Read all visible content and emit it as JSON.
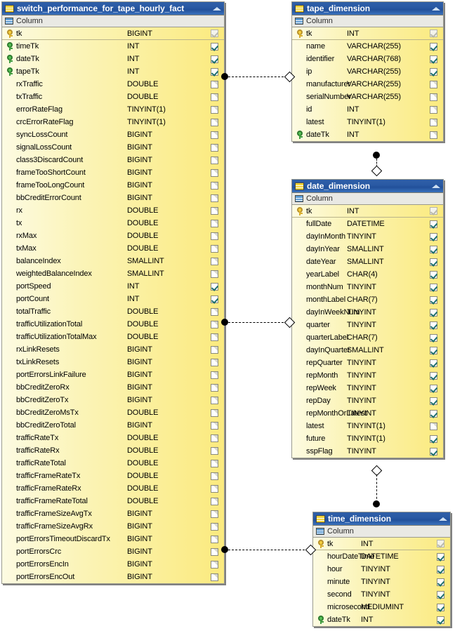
{
  "diagram": {
    "group_header_label": "Column",
    "tables": [
      {
        "id": "fact",
        "name": "switch_performance_for_tape_hourly_fact",
        "columns": [
          {
            "name": "tk",
            "type": "BIGINT",
            "key": "pk",
            "checked": "disabled"
          },
          {
            "name": "timeTk",
            "type": "INT",
            "key": "fk",
            "checked": "checked"
          },
          {
            "name": "dateTk",
            "type": "INT",
            "key": "fk",
            "checked": "checked"
          },
          {
            "name": "tapeTk",
            "type": "INT",
            "key": "fk",
            "checked": "checked"
          },
          {
            "name": "rxTraffic",
            "type": "DOUBLE",
            "key": "",
            "checked": "empty"
          },
          {
            "name": "txTraffic",
            "type": "DOUBLE",
            "key": "",
            "checked": "empty"
          },
          {
            "name": "errorRateFlag",
            "type": "TINYINT(1)",
            "key": "",
            "checked": "empty"
          },
          {
            "name": "crcErrorRateFlag",
            "type": "TINYINT(1)",
            "key": "",
            "checked": "empty"
          },
          {
            "name": "syncLossCount",
            "type": "BIGINT",
            "key": "",
            "checked": "empty"
          },
          {
            "name": "signalLossCount",
            "type": "BIGINT",
            "key": "",
            "checked": "empty"
          },
          {
            "name": "class3DiscardCount",
            "type": "BIGINT",
            "key": "",
            "checked": "empty"
          },
          {
            "name": "frameTooShortCount",
            "type": "BIGINT",
            "key": "",
            "checked": "empty"
          },
          {
            "name": "frameTooLongCount",
            "type": "BIGINT",
            "key": "",
            "checked": "empty"
          },
          {
            "name": "bbCreditErrorCount",
            "type": "BIGINT",
            "key": "",
            "checked": "empty"
          },
          {
            "name": "rx",
            "type": "DOUBLE",
            "key": "",
            "checked": "empty"
          },
          {
            "name": "tx",
            "type": "DOUBLE",
            "key": "",
            "checked": "empty"
          },
          {
            "name": "rxMax",
            "type": "DOUBLE",
            "key": "",
            "checked": "empty"
          },
          {
            "name": "txMax",
            "type": "DOUBLE",
            "key": "",
            "checked": "empty"
          },
          {
            "name": "balanceIndex",
            "type": "SMALLINT",
            "key": "",
            "checked": "empty"
          },
          {
            "name": "weightedBalanceIndex",
            "type": "SMALLINT",
            "key": "",
            "checked": "empty"
          },
          {
            "name": "portSpeed",
            "type": "INT",
            "key": "",
            "checked": "checked"
          },
          {
            "name": "portCount",
            "type": "INT",
            "key": "",
            "checked": "checked"
          },
          {
            "name": "totalTraffic",
            "type": "DOUBLE",
            "key": "",
            "checked": "empty"
          },
          {
            "name": "trafficUtilizationTotal",
            "type": "DOUBLE",
            "key": "",
            "checked": "empty"
          },
          {
            "name": "trafficUtilizationTotalMax",
            "type": "DOUBLE",
            "key": "",
            "checked": "empty"
          },
          {
            "name": "rxLinkResets",
            "type": "BIGINT",
            "key": "",
            "checked": "empty"
          },
          {
            "name": "txLinkResets",
            "type": "BIGINT",
            "key": "",
            "checked": "empty"
          },
          {
            "name": "portErrorsLinkFailure",
            "type": "BIGINT",
            "key": "",
            "checked": "empty"
          },
          {
            "name": "bbCreditZeroRx",
            "type": "BIGINT",
            "key": "",
            "checked": "empty"
          },
          {
            "name": "bbCreditZeroTx",
            "type": "BIGINT",
            "key": "",
            "checked": "empty"
          },
          {
            "name": "bbCreditZeroMsTx",
            "type": "DOUBLE",
            "key": "",
            "checked": "empty"
          },
          {
            "name": "bbCreditZeroTotal",
            "type": "BIGINT",
            "key": "",
            "checked": "empty"
          },
          {
            "name": "trafficRateTx",
            "type": "DOUBLE",
            "key": "",
            "checked": "empty"
          },
          {
            "name": "trafficRateRx",
            "type": "DOUBLE",
            "key": "",
            "checked": "empty"
          },
          {
            "name": "trafficRateTotal",
            "type": "DOUBLE",
            "key": "",
            "checked": "empty"
          },
          {
            "name": "trafficFrameRateTx",
            "type": "DOUBLE",
            "key": "",
            "checked": "empty"
          },
          {
            "name": "trafficFrameRateRx",
            "type": "DOUBLE",
            "key": "",
            "checked": "empty"
          },
          {
            "name": "trafficFrameRateTotal",
            "type": "DOUBLE",
            "key": "",
            "checked": "empty"
          },
          {
            "name": "trafficFrameSizeAvgTx",
            "type": "BIGINT",
            "key": "",
            "checked": "empty"
          },
          {
            "name": "trafficFrameSizeAvgRx",
            "type": "BIGINT",
            "key": "",
            "checked": "empty"
          },
          {
            "name": "portErrorsTimeoutDiscardTx",
            "type": "BIGINT",
            "key": "",
            "checked": "empty"
          },
          {
            "name": "portErrorsCrc",
            "type": "BIGINT",
            "key": "",
            "checked": "empty"
          },
          {
            "name": "portErrorsEncIn",
            "type": "BIGINT",
            "key": "",
            "checked": "empty"
          },
          {
            "name": "portErrorsEncOut",
            "type": "BIGINT",
            "key": "",
            "checked": "empty"
          }
        ]
      },
      {
        "id": "tape",
        "name": "tape_dimension",
        "columns": [
          {
            "name": "tk",
            "type": "INT",
            "key": "pk",
            "checked": "disabled"
          },
          {
            "name": "name",
            "type": "VARCHAR(255)",
            "key": "",
            "checked": "checked"
          },
          {
            "name": "identifier",
            "type": "VARCHAR(768)",
            "key": "",
            "checked": "checked"
          },
          {
            "name": "ip",
            "type": "VARCHAR(255)",
            "key": "",
            "checked": "checked"
          },
          {
            "name": "manufacturer",
            "type": "VARCHAR(255)",
            "key": "",
            "checked": "empty"
          },
          {
            "name": "serialNumber",
            "type": "VARCHAR(255)",
            "key": "",
            "checked": "empty"
          },
          {
            "name": "id",
            "type": "INT",
            "key": "",
            "checked": "empty"
          },
          {
            "name": "latest",
            "type": "TINYINT(1)",
            "key": "",
            "checked": "empty"
          },
          {
            "name": "dateTk",
            "type": "INT",
            "key": "fk",
            "checked": "empty"
          }
        ]
      },
      {
        "id": "date",
        "name": "date_dimension",
        "columns": [
          {
            "name": "tk",
            "type": "INT",
            "key": "pk",
            "checked": "disabled"
          },
          {
            "name": "fullDate",
            "type": "DATETIME",
            "key": "",
            "checked": "checked"
          },
          {
            "name": "dayInMonth",
            "type": "TINYINT",
            "key": "",
            "checked": "checked"
          },
          {
            "name": "dayInYear",
            "type": "SMALLINT",
            "key": "",
            "checked": "checked"
          },
          {
            "name": "dateYear",
            "type": "SMALLINT",
            "key": "",
            "checked": "checked"
          },
          {
            "name": "yearLabel",
            "type": "CHAR(4)",
            "key": "",
            "checked": "checked"
          },
          {
            "name": "monthNum",
            "type": "TINYINT",
            "key": "",
            "checked": "checked"
          },
          {
            "name": "monthLabel",
            "type": "CHAR(7)",
            "key": "",
            "checked": "checked"
          },
          {
            "name": "dayInWeekNum",
            "type": "TINYINT",
            "key": "",
            "checked": "checked"
          },
          {
            "name": "quarter",
            "type": "TINYINT",
            "key": "",
            "checked": "checked"
          },
          {
            "name": "quarterLabel",
            "type": "CHAR(7)",
            "key": "",
            "checked": "checked"
          },
          {
            "name": "dayInQuarter",
            "type": "SMALLINT",
            "key": "",
            "checked": "checked"
          },
          {
            "name": "repQuarter",
            "type": "TINYINT",
            "key": "",
            "checked": "checked"
          },
          {
            "name": "repMonth",
            "type": "TINYINT",
            "key": "",
            "checked": "checked"
          },
          {
            "name": "repWeek",
            "type": "TINYINT",
            "key": "",
            "checked": "checked"
          },
          {
            "name": "repDay",
            "type": "TINYINT",
            "key": "",
            "checked": "checked"
          },
          {
            "name": "repMonthOrLatest",
            "type": "TINYINT",
            "key": "",
            "checked": "checked"
          },
          {
            "name": "latest",
            "type": "TINYINT(1)",
            "key": "",
            "checked": "empty"
          },
          {
            "name": "future",
            "type": "TINYINT(1)",
            "key": "",
            "checked": "checked"
          },
          {
            "name": "sspFlag",
            "type": "TINYINT",
            "key": "",
            "checked": "checked"
          }
        ]
      },
      {
        "id": "time",
        "name": "time_dimension",
        "columns": [
          {
            "name": "tk",
            "type": "INT",
            "key": "pk",
            "checked": "disabled"
          },
          {
            "name": "hourDateTime",
            "type": "DATETIME",
            "key": "",
            "checked": "checked"
          },
          {
            "name": "hour",
            "type": "TINYINT",
            "key": "",
            "checked": "checked"
          },
          {
            "name": "minute",
            "type": "TINYINT",
            "key": "",
            "checked": "checked"
          },
          {
            "name": "second",
            "type": "TINYINT",
            "key": "",
            "checked": "checked"
          },
          {
            "name": "microsecond",
            "type": "MEDIUMINT",
            "key": "",
            "checked": "checked"
          },
          {
            "name": "dateTk",
            "type": "INT",
            "key": "fk",
            "checked": "checked"
          }
        ]
      }
    ],
    "relationships": [
      {
        "id": "fact-tape",
        "from": "fact",
        "to": "tape"
      },
      {
        "id": "fact-date",
        "from": "fact",
        "to": "date"
      },
      {
        "id": "fact-time",
        "from": "fact",
        "to": "time"
      },
      {
        "id": "tape-date",
        "from": "tape",
        "to": "date"
      },
      {
        "id": "date-time",
        "from": "time",
        "to": "date"
      }
    ]
  }
}
